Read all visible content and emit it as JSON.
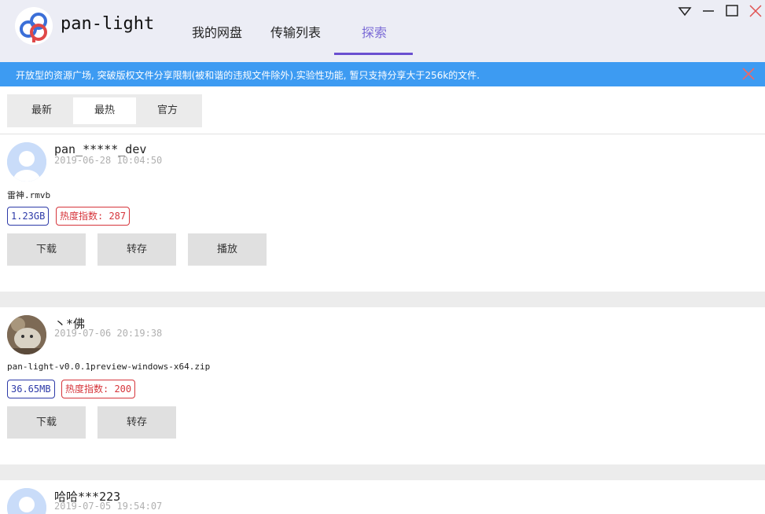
{
  "app": {
    "title": "pan-light"
  },
  "nav": {
    "tabs": [
      {
        "label": "我的网盘"
      },
      {
        "label": "传输列表"
      },
      {
        "label": "探索"
      }
    ],
    "active_index": 2
  },
  "window_controls": [
    "dropdown-icon",
    "minimize-icon",
    "maximize-icon",
    "close-icon"
  ],
  "notice": {
    "text": "开放型的资源广场, 突破版权文件分享限制(被和谐的违规文件除外).实验性功能, 暂只支持分享大于256k的文件."
  },
  "filters": {
    "tabs": [
      {
        "label": "最新"
      },
      {
        "label": "最热"
      },
      {
        "label": "官方"
      }
    ],
    "active_index": 1
  },
  "shares": [
    {
      "username": "pan_*****_dev",
      "timestamp": "2019-06-28 10:04:50",
      "filename": "雷神.rmvb",
      "size": "1.23GB",
      "heat": "热度指数: 287",
      "actions": [
        "下载",
        "转存",
        "播放"
      ]
    },
    {
      "username": "丶*佛",
      "timestamp": "2019-07-06 20:19:38",
      "filename": "pan-light-v0.0.1preview-windows-x64.zip",
      "size": "36.65MB",
      "heat": "热度指数: 200",
      "actions": [
        "下载",
        "转存"
      ]
    },
    {
      "username": "哈哈***223",
      "timestamp": "2019-07-05 19:54:07"
    }
  ],
  "colors": {
    "accent": "#6a4fd0",
    "notice_bg": "#3d9bf2",
    "size_badge": "#2d3aa8",
    "heat_badge": "#d6353b",
    "window_close": "#e05050"
  }
}
